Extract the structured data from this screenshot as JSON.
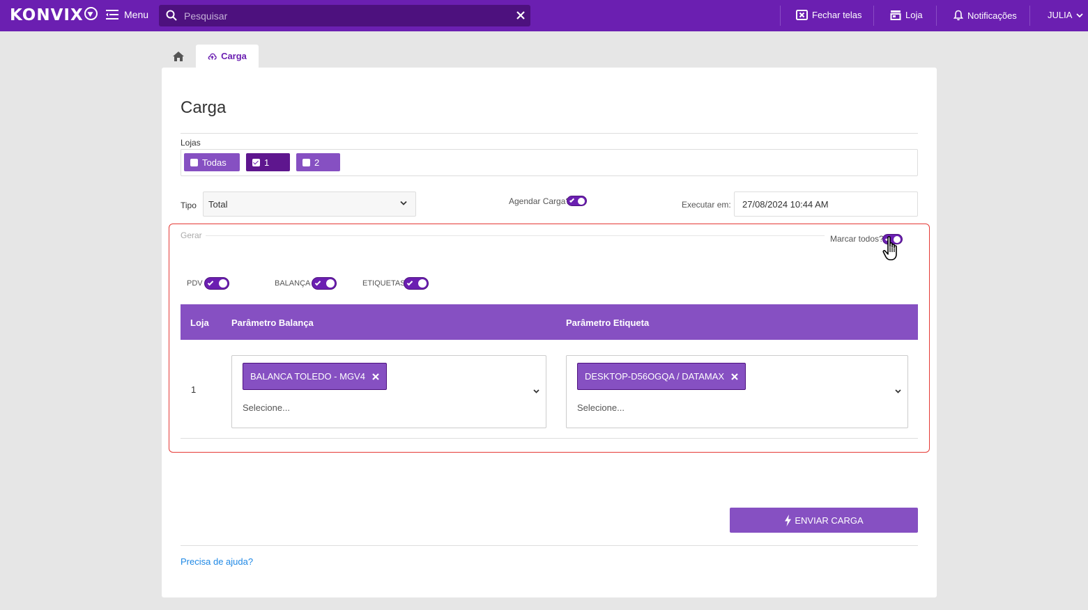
{
  "header": {
    "logo": "KONVIX",
    "menu_label": "Menu",
    "search_placeholder": "Pesquisar",
    "close_screens_label": "Fechar telas",
    "store_label": "Loja",
    "notifications_label": "Notificações",
    "user_label": "JULIA"
  },
  "tabs": [
    {
      "label": "Carga",
      "active": true
    }
  ],
  "page": {
    "title": "Carga",
    "lojas_label": "Lojas",
    "lojas": [
      {
        "label": "Todas",
        "checked": false,
        "color": "#8650c2"
      },
      {
        "label": "1",
        "checked": true,
        "color": "#5e168e"
      },
      {
        "label": "2",
        "checked": false,
        "color": "#8650c2"
      }
    ],
    "tipo_label": "Tipo",
    "tipo_value": "Total",
    "agendar_label": "Agendar Carga?",
    "agendar_on": true,
    "executar_label": "Executar em:",
    "executar_value": "27/08/2024 10:44 AM",
    "gerar_legend": "Gerar",
    "marcar_todos_label": "Marcar todos?",
    "marcar_todos_on": true,
    "toggles": [
      {
        "label": "PDV",
        "on": true
      },
      {
        "label": "BALANÇA",
        "on": true
      },
      {
        "label": "ETIQUETAS",
        "on": true
      }
    ],
    "table": {
      "headers": [
        "Loja",
        "Parâmetro Balança",
        "Parâmetro Etiqueta"
      ],
      "rows": [
        {
          "loja": "1",
          "balanca_tag": "BALANCA TOLEDO - MGV4",
          "balanca_placeholder": "Selecione...",
          "etiqueta_tag": "DESKTOP-D56OGQA / DATAMAX",
          "etiqueta_placeholder": "Selecione..."
        }
      ]
    },
    "send_button": "ENVIAR CARGA",
    "help_link": "Precisa de ajuda?"
  },
  "colors": {
    "brand": "#6b1fb1",
    "accent": "#8650c2",
    "highlight_border": "#e53935",
    "link": "#1e88e5"
  }
}
